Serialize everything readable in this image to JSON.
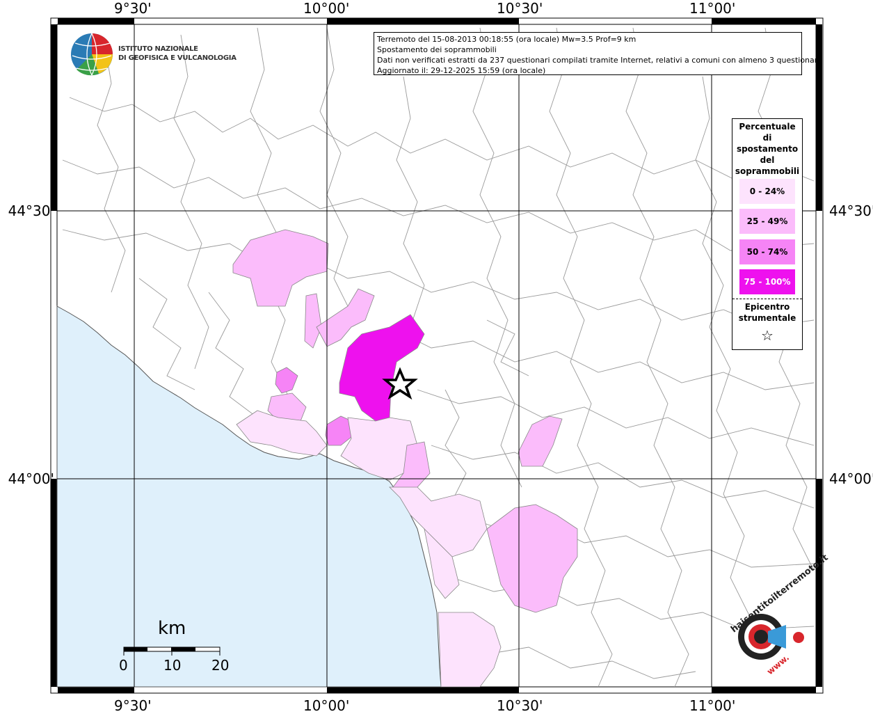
{
  "info": {
    "line1": "Terremoto del 15-08-2013 00:18:55 (ora locale) Mw=3.5 Prof=9 km",
    "line2": "Spostamento dei soprammobili",
    "line3": "Dati non verificati estratti da 237 questionari compilati tramite Internet, relativi a comuni con almeno 3 questionari.",
    "line4": "Aggiornato il: 29-12-2025 15:59 (ora locale)"
  },
  "ingv": {
    "line1": "ISTITUTO NAZIONALE",
    "line2": "DI GEOFISICA E VULCANOLOGIA"
  },
  "axes": {
    "lon_labels": [
      "9°30'",
      "10°00'",
      "10°30'",
      "11°00'"
    ],
    "lat_labels": [
      "44°30'",
      "44°00'"
    ]
  },
  "legend": {
    "title": [
      "Percentuale",
      "di",
      "spostamento",
      "del",
      "soprammobili"
    ],
    "items": [
      {
        "label": "0 - 24%",
        "color": "#fde3fd"
      },
      {
        "label": "25 - 49%",
        "color": "#fbbcfb"
      },
      {
        "label": "50 - 74%",
        "color": "#f684f6"
      },
      {
        "label": "75 - 100%",
        "color": "#ee11ee"
      }
    ],
    "epicentre": [
      "Epicentro",
      "strumentale"
    ],
    "star_symbol": "☆"
  },
  "scale": {
    "title": "km",
    "labels": [
      "0",
      "10",
      "20"
    ]
  },
  "logo": {
    "text": "haisentitoilterremoto.it",
    "url": "www."
  },
  "colors": {
    "sea": "#dff0fb",
    "grid": "#000000",
    "borders": "#9a9a9a"
  }
}
